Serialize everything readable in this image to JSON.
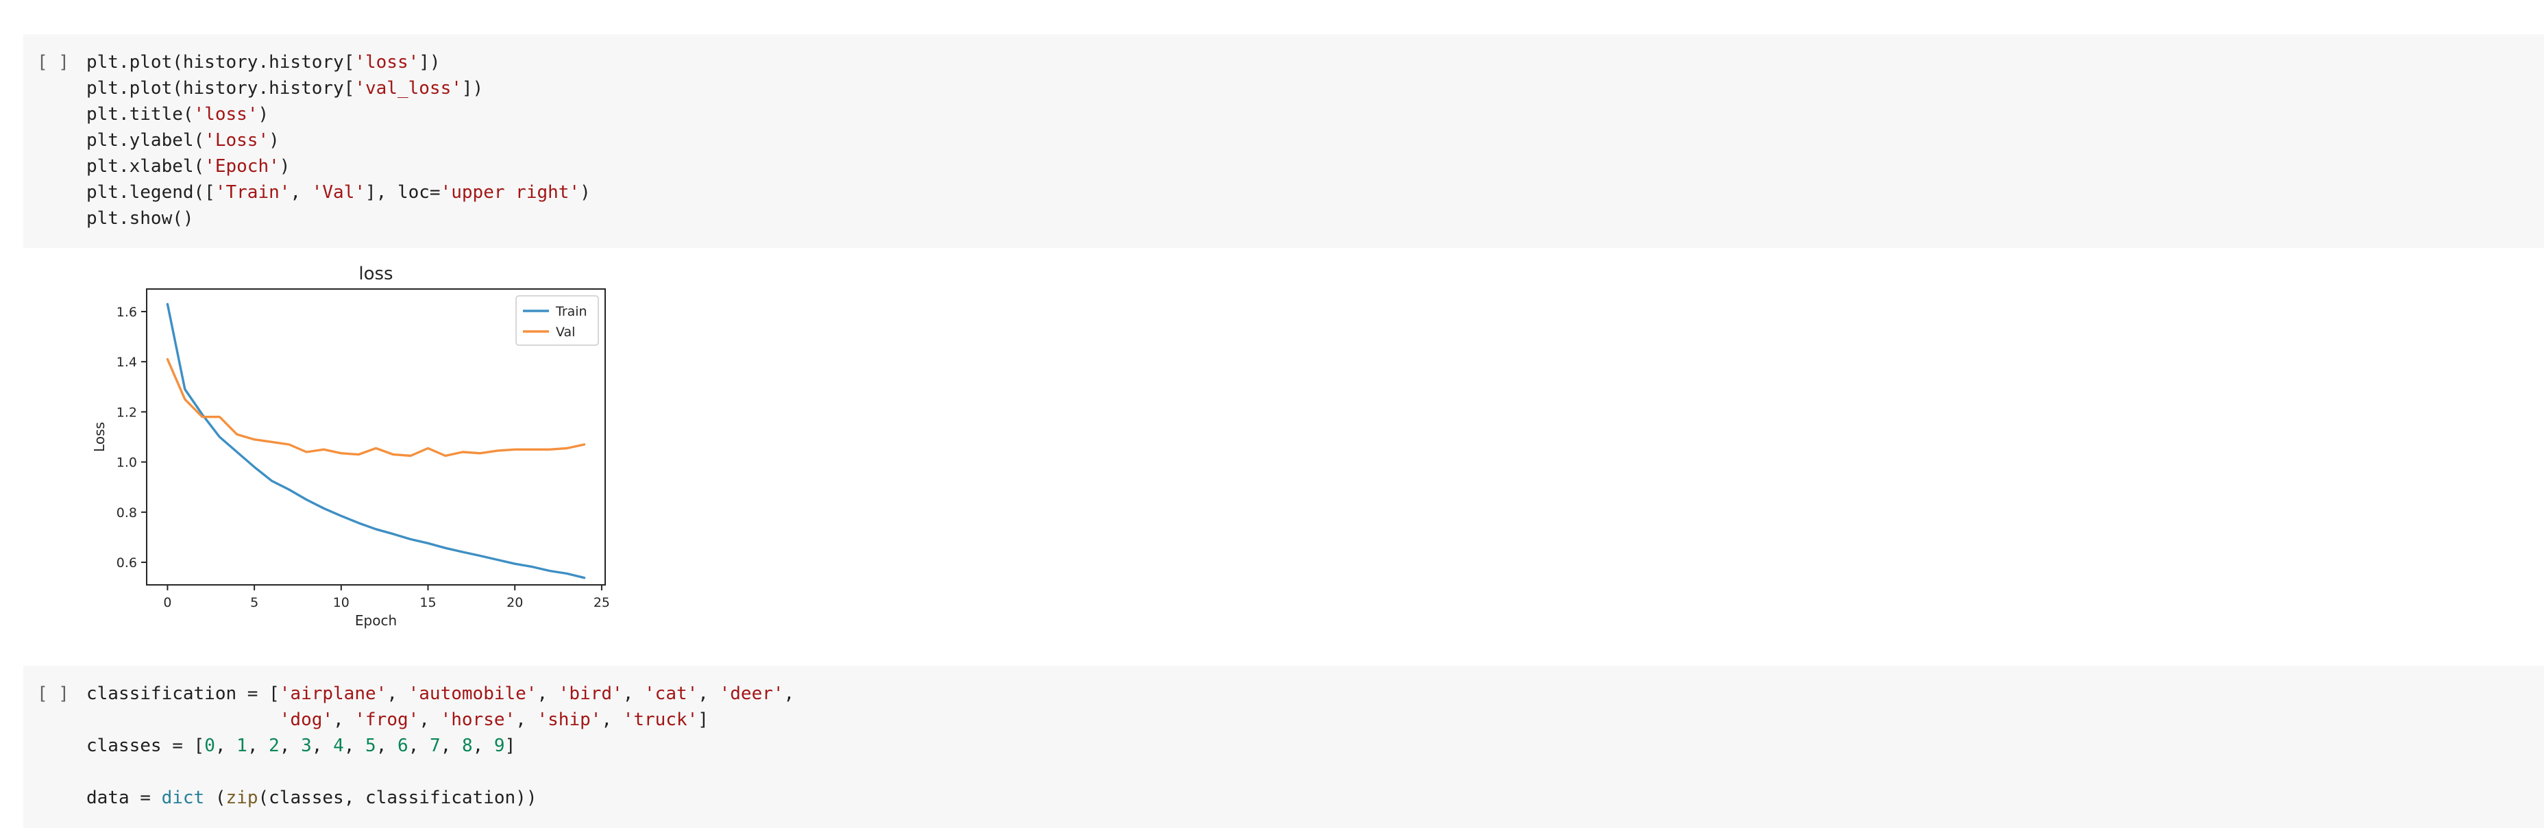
{
  "cells": [
    {
      "run_label": "[ ]",
      "lines": [
        [
          {
            "t": "plt.plot(history.history["
          },
          {
            "t": "'loss'",
            "c": "s"
          },
          {
            "t": "])"
          }
        ],
        [
          {
            "t": "plt.plot(history.history["
          },
          {
            "t": "'val_loss'",
            "c": "s"
          },
          {
            "t": "])"
          }
        ],
        [
          {
            "t": "plt.title("
          },
          {
            "t": "'loss'",
            "c": "s"
          },
          {
            "t": ")"
          }
        ],
        [
          {
            "t": "plt.ylabel("
          },
          {
            "t": "'Loss'",
            "c": "s"
          },
          {
            "t": ")"
          }
        ],
        [
          {
            "t": "plt.xlabel("
          },
          {
            "t": "'Epoch'",
            "c": "s"
          },
          {
            "t": ")"
          }
        ],
        [
          {
            "t": "plt.legend(["
          },
          {
            "t": "'Train'",
            "c": "s"
          },
          {
            "t": ", "
          },
          {
            "t": "'Val'",
            "c": "s"
          },
          {
            "t": "], loc="
          },
          {
            "t": "'upper right'",
            "c": "s"
          },
          {
            "t": ")"
          }
        ],
        [
          {
            "t": "plt.show()"
          }
        ]
      ]
    },
    {
      "run_label": "[ ]",
      "lines": [
        [
          {
            "t": "classification = ["
          },
          {
            "t": "'airplane'",
            "c": "s"
          },
          {
            "t": ", "
          },
          {
            "t": "'automobile'",
            "c": "s"
          },
          {
            "t": ", "
          },
          {
            "t": "'bird'",
            "c": "s"
          },
          {
            "t": ", "
          },
          {
            "t": "'cat'",
            "c": "s"
          },
          {
            "t": ", "
          },
          {
            "t": "'deer'",
            "c": "s"
          },
          {
            "t": ","
          }
        ],
        [
          {
            "t": "                  "
          },
          {
            "t": "'dog'",
            "c": "s"
          },
          {
            "t": ", "
          },
          {
            "t": "'frog'",
            "c": "s"
          },
          {
            "t": ", "
          },
          {
            "t": "'horse'",
            "c": "s"
          },
          {
            "t": ", "
          },
          {
            "t": "'ship'",
            "c": "s"
          },
          {
            "t": ", "
          },
          {
            "t": "'truck'",
            "c": "s"
          },
          {
            "t": "]"
          }
        ],
        [
          {
            "t": "classes = ["
          },
          {
            "t": "0",
            "c": "n"
          },
          {
            "t": ", "
          },
          {
            "t": "1",
            "c": "n"
          },
          {
            "t": ", "
          },
          {
            "t": "2",
            "c": "n"
          },
          {
            "t": ", "
          },
          {
            "t": "3",
            "c": "n"
          },
          {
            "t": ", "
          },
          {
            "t": "4",
            "c": "n"
          },
          {
            "t": ", "
          },
          {
            "t": "5",
            "c": "n"
          },
          {
            "t": ", "
          },
          {
            "t": "6",
            "c": "n"
          },
          {
            "t": ", "
          },
          {
            "t": "7",
            "c": "n"
          },
          {
            "t": ", "
          },
          {
            "t": "8",
            "c": "n"
          },
          {
            "t": ", "
          },
          {
            "t": "9",
            "c": "n"
          },
          {
            "t": "]"
          }
        ],
        [],
        [
          {
            "t": "data = "
          },
          {
            "t": "dict",
            "c": "b"
          },
          {
            "t": " ("
          },
          {
            "t": "zip",
            "c": "f"
          },
          {
            "t": "(classes, classification))"
          }
        ]
      ]
    }
  ],
  "colors": {
    "string": "#a31515",
    "number": "#098658",
    "builtin": "#267f99",
    "function": "#795e26",
    "train_line": "#3d8fc4",
    "val_line": "#f5913e"
  },
  "chart_data": {
    "type": "line",
    "title": "loss",
    "xlabel": "Epoch",
    "ylabel": "Loss",
    "xlim": [
      -1.2,
      25.2
    ],
    "ylim": [
      0.51,
      1.69
    ],
    "xticks": [
      0,
      5,
      10,
      15,
      20,
      25
    ],
    "yticks": [
      0.6,
      0.8,
      1.0,
      1.2,
      1.4,
      1.6
    ],
    "legend_position": "upper right",
    "grid": false,
    "x": [
      0,
      1,
      2,
      3,
      4,
      5,
      6,
      7,
      8,
      9,
      10,
      11,
      12,
      13,
      14,
      15,
      16,
      17,
      18,
      19,
      20,
      21,
      22,
      23,
      24
    ],
    "series": [
      {
        "name": "Train",
        "color": "#3d8fc4",
        "values": [
          1.63,
          1.29,
          1.19,
          1.1,
          1.04,
          0.98,
          0.925,
          0.89,
          0.85,
          0.815,
          0.785,
          0.757,
          0.732,
          0.713,
          0.692,
          0.676,
          0.657,
          0.641,
          0.626,
          0.61,
          0.594,
          0.582,
          0.566,
          0.555,
          0.538
        ]
      },
      {
        "name": "Val",
        "color": "#f5913e",
        "values": [
          1.41,
          1.25,
          1.18,
          1.18,
          1.11,
          1.09,
          1.08,
          1.07,
          1.04,
          1.05,
          1.035,
          1.03,
          1.055,
          1.03,
          1.025,
          1.055,
          1.025,
          1.04,
          1.035,
          1.045,
          1.05,
          1.05,
          1.05,
          1.055,
          1.07
        ]
      }
    ]
  }
}
